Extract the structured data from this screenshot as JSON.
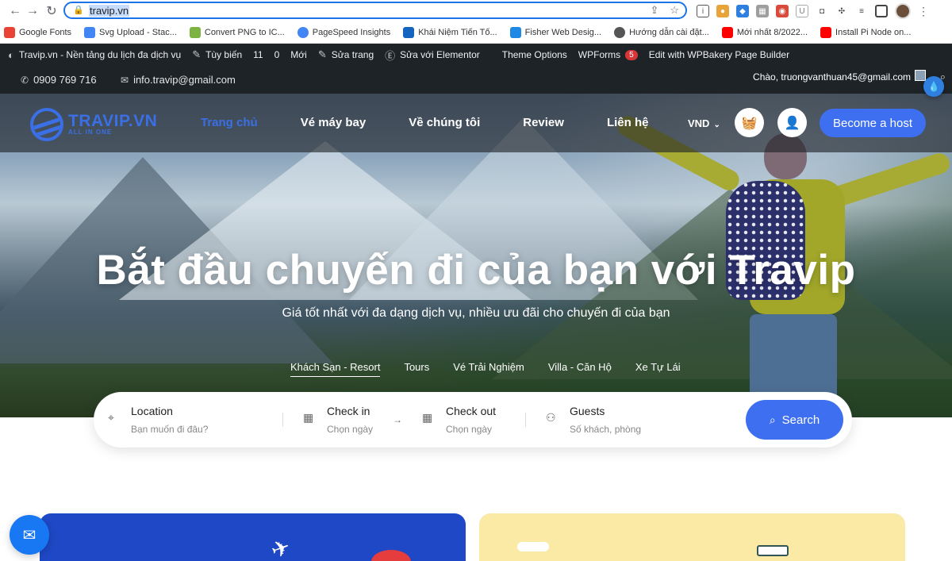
{
  "browser": {
    "url": "travip.vn",
    "bookmarks": [
      {
        "label": "Google Fonts",
        "color": "#ea4335"
      },
      {
        "label": "Svg Upload - Stac...",
        "color": "#4285f4"
      },
      {
        "label": "Convert PNG to IC...",
        "color": "#7cb342"
      },
      {
        "label": "PageSpeed Insights",
        "color": "#4285f4"
      },
      {
        "label": "Khái Niệm Tiến Tố...",
        "color": "#1565c0"
      },
      {
        "label": "Fisher Web Desig...",
        "color": "#1e88e5"
      },
      {
        "label": "Hướng dẫn cài đặt...",
        "color": "#555555"
      },
      {
        "label": "Mới nhất 8/2022...",
        "color": "#ff0000"
      },
      {
        "label": "Install Pi Node on...",
        "color": "#ff0000"
      }
    ]
  },
  "wpbar": {
    "site": "Travip.vn - Nền tảng du lịch đa dịch vụ",
    "customize": "Tùy biến",
    "updates": "11",
    "comments": "0",
    "new": "Mới",
    "edit_page": "Sửa trang",
    "elementor": "Sửa với Elementor",
    "theme_options": "Theme Options",
    "wpforms": "WPForms",
    "wpforms_badge": "5",
    "wpbakery": "Edit with WPBakery Page Builder"
  },
  "topbar": {
    "phone": "0909 769 716",
    "email": "info.travip@gmail.com",
    "greeting": "Chào, truongvanthuan45@gmail.com"
  },
  "header": {
    "logo_name": "TRAVIP.VN",
    "logo_sub": "ALL IN ONE",
    "menu": [
      "Trang chủ",
      "Vé máy bay",
      "Về chúng tôi",
      "Review",
      "Liên hệ"
    ],
    "currency": "VND",
    "host_button": "Become a host",
    "accent": "#3d6ff0"
  },
  "hero": {
    "title": "Bắt đầu chuyến đi của bạn với Travip",
    "subtitle": "Giá tốt nhất với đa dạng dịch vụ, nhiều ưu đãi cho chuyến đi của bạn",
    "tabs": [
      "Khách Sạn - Resort",
      "Tours",
      "Vé Trải Nghiệm",
      "Villa - Căn Hộ",
      "Xe Tự Lái"
    ]
  },
  "search": {
    "location_label": "Location",
    "location_hint": "Bạn muốn đi đâu?",
    "checkin_label": "Check in",
    "checkin_hint": "Chọn ngày",
    "checkout_label": "Check out",
    "checkout_hint": "Chọn ngày",
    "guests_label": "Guests",
    "guests_hint": "Số khách, phòng",
    "button": "Search"
  }
}
